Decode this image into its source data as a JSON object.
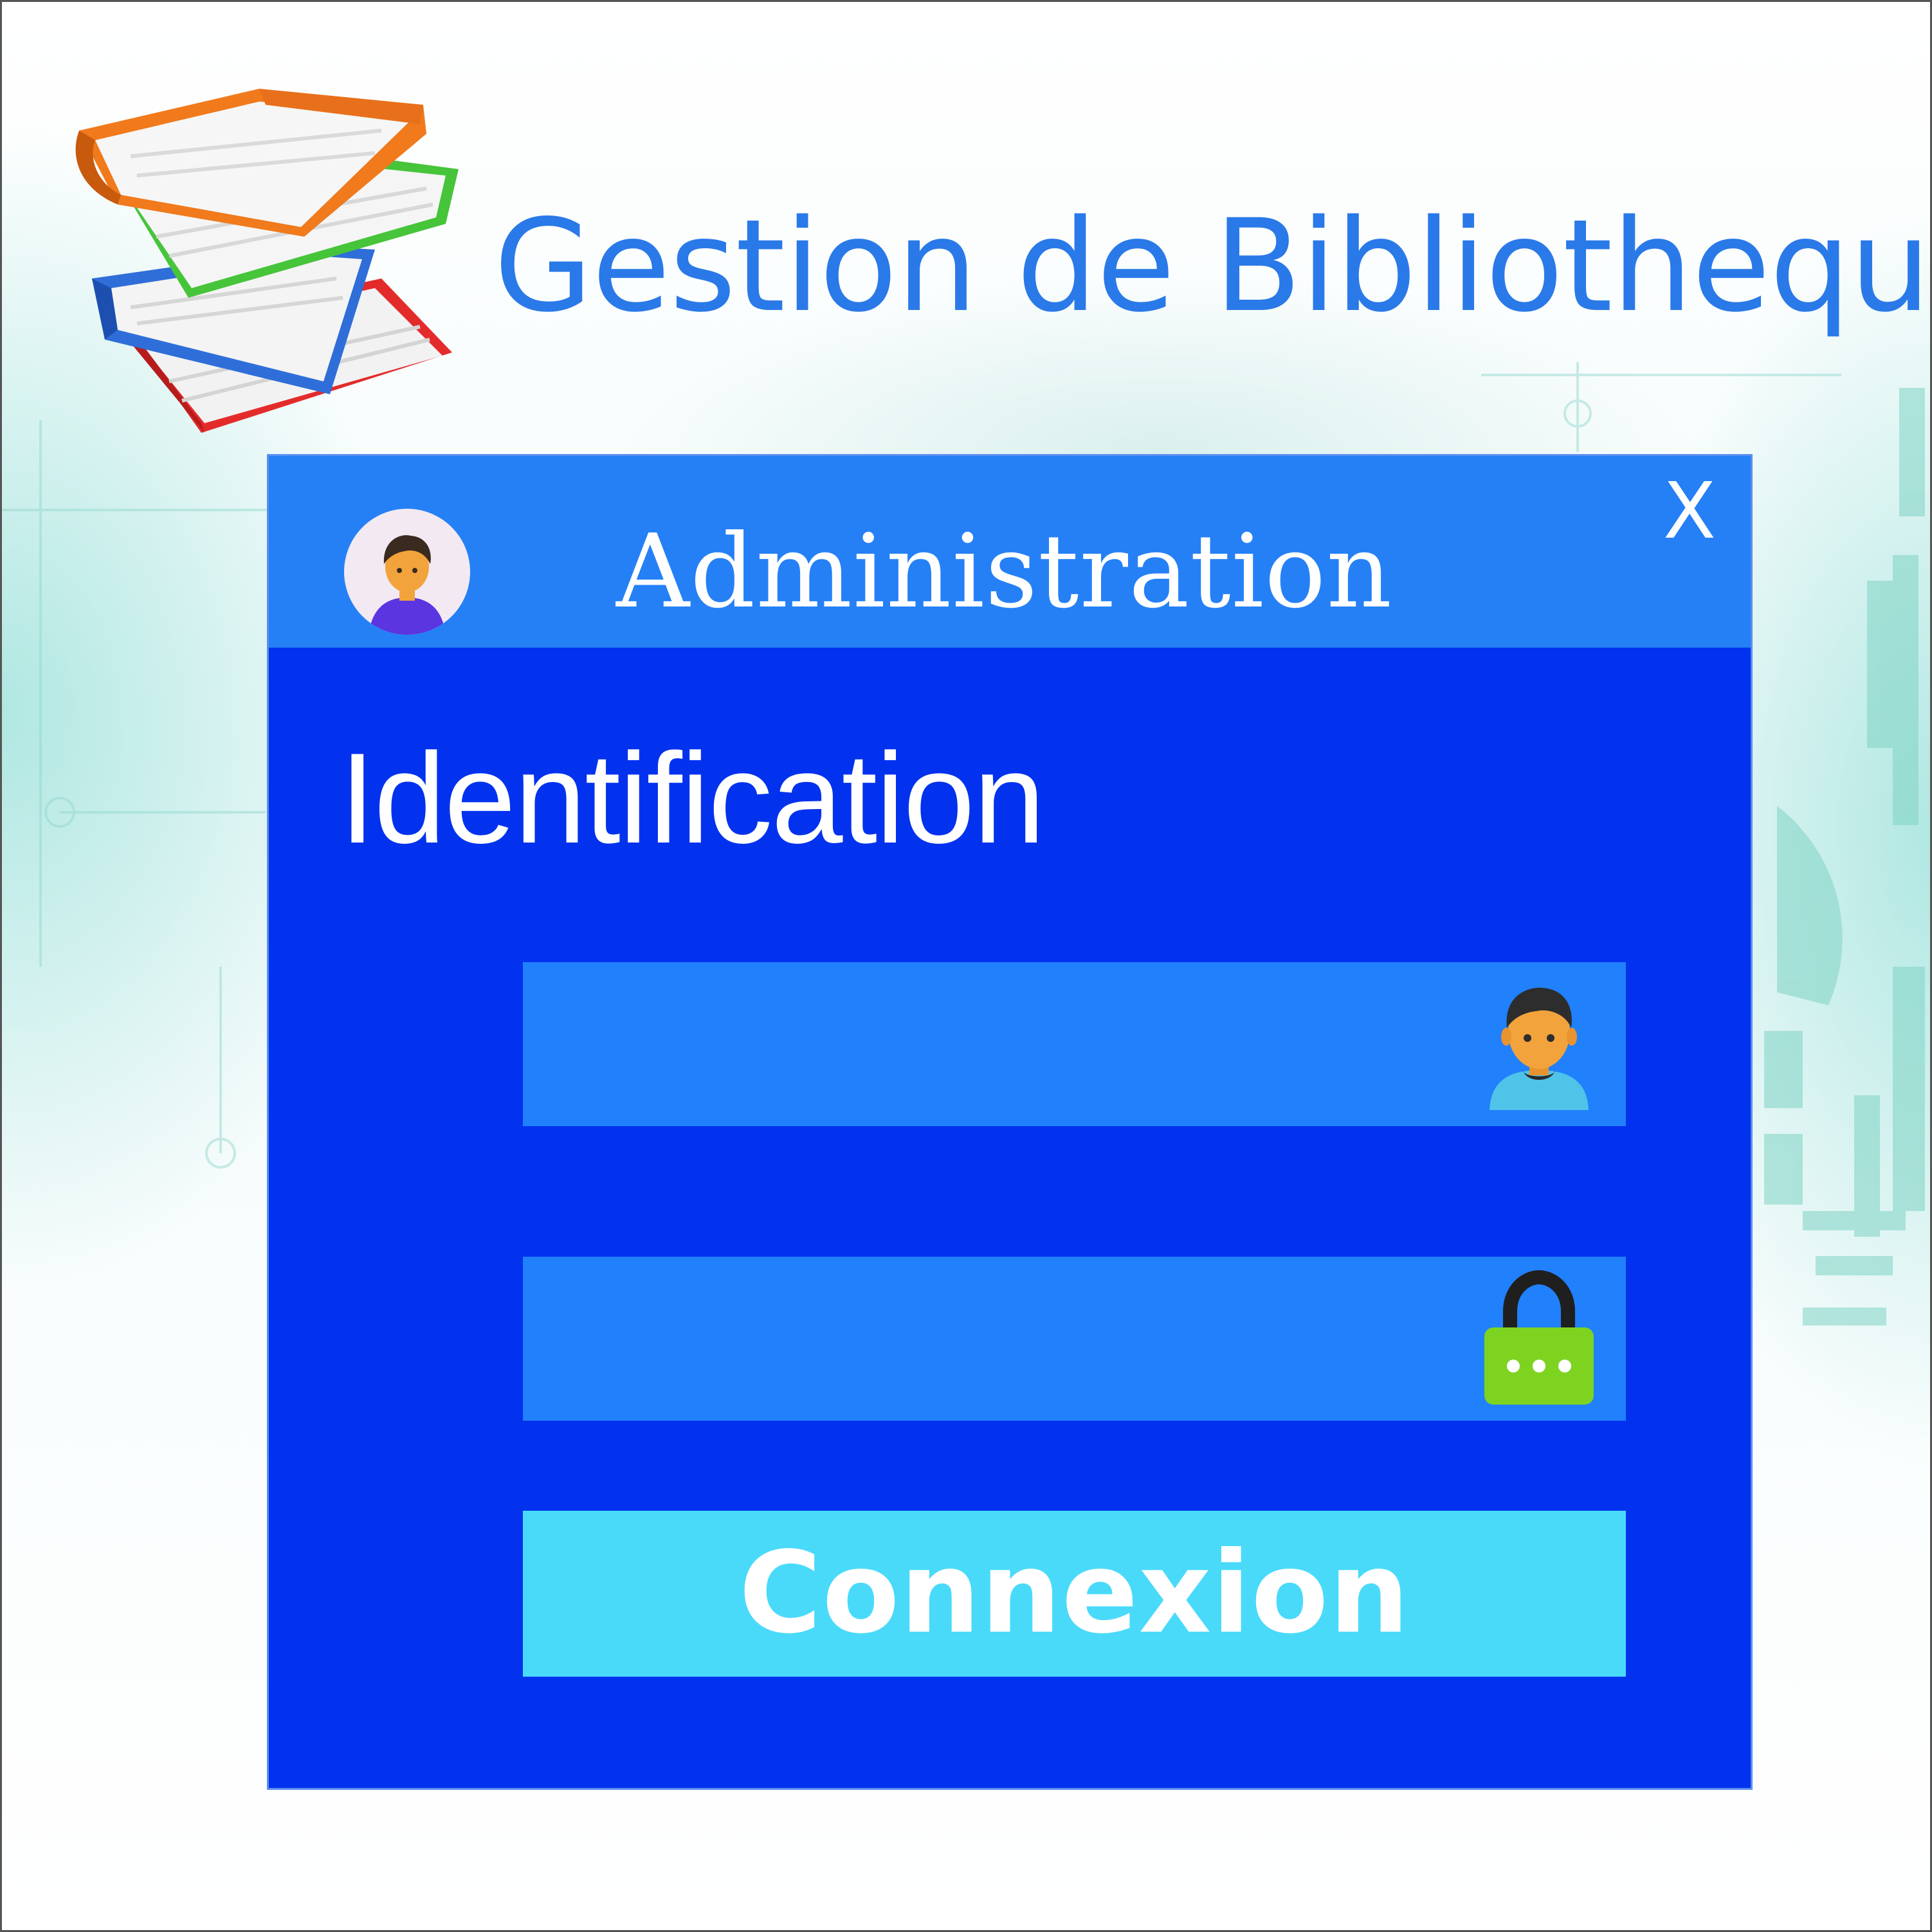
{
  "app": {
    "title": "Gestion de Bibliotheque",
    "logo_icon": "books-stack-icon"
  },
  "dialog": {
    "title": "Administration",
    "avatar_icon": "admin-avatar-icon",
    "close_label": "X",
    "section_heading": "Identification",
    "username": {
      "value": "",
      "placeholder": "",
      "icon": "user-icon"
    },
    "password": {
      "value": "",
      "placeholder": "",
      "icon": "lock-icon"
    },
    "submit_label": "Connexion"
  },
  "colors": {
    "title_text": "#2a79e8",
    "dialog_body": "#0332ee",
    "title_bar": "#2580f6",
    "input_background": "#2180fc",
    "button_background": "#49dafa",
    "lock_body": "#7ed321"
  }
}
